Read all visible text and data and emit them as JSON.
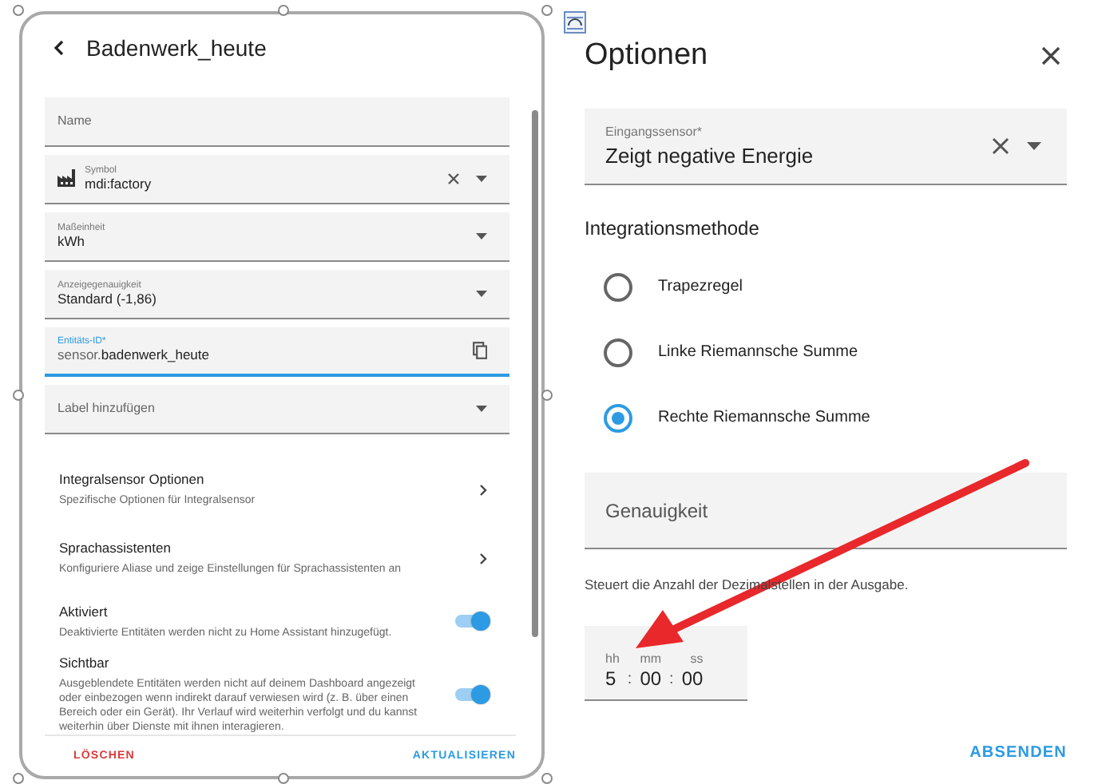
{
  "entity_dialog": {
    "title": "Badenwerk_heute",
    "fields": [
      {
        "kind": "text",
        "label": "Name"
      },
      {
        "kind": "icon-select",
        "label": "Symbol",
        "value": "mdi:factory"
      },
      {
        "kind": "select",
        "label": "Maßeinheit",
        "value": "kWh"
      },
      {
        "kind": "select",
        "label": "Anzeigegenauigkeit",
        "value": "Standard (-1,86)"
      },
      {
        "kind": "id",
        "label": "Entitäts-ID*",
        "prefix": "sensor.",
        "value": "badenwerk_heute",
        "focused": true
      },
      {
        "kind": "select",
        "label": "Label hinzufügen"
      }
    ],
    "links": [
      {
        "title": "Integralsensor Optionen",
        "description": "Spezifische Optionen für Integralsensor"
      },
      {
        "title": "Sprachassistenten",
        "description": "Konfiguriere Aliase und zeige Einstellungen für Sprachassistenten an"
      }
    ],
    "toggles": [
      {
        "title": "Aktiviert",
        "description": "Deaktivierte Entitäten werden nicht zu Home Assistant hinzugefügt.",
        "on": true
      },
      {
        "title": "Sichtbar",
        "description": "Ausgeblendete Entitäten werden nicht auf deinem Dashboard angezeigt oder einbezogen wenn indirekt darauf verwiesen wird (z. B. über einen Bereich oder ein Gerät). Ihr Verlauf wird weiterhin verfolgt und du kannst weiterhin über Dienste mit ihnen interagieren.",
        "on": true
      }
    ],
    "delete_button": "LÖSCHEN",
    "update_button": "AKTUALISIEREN"
  },
  "options_dialog": {
    "title": "Optionen",
    "input_sensor": {
      "label": "Eingangssensor*",
      "value": "Zeigt negative Energie"
    },
    "method_heading": "Integrationsmethode",
    "methods": [
      {
        "label": "Trapezregel",
        "selected": false
      },
      {
        "label": "Linke Riemannsche Summe",
        "selected": false
      },
      {
        "label": "Rechte Riemannsche Summe",
        "selected": true
      }
    ],
    "precision": {
      "placeholder": "Genauigkeit",
      "helper": "Steuert die Anzahl der Dezimalstellen in der Ausgabe."
    },
    "duration": [
      {
        "unit": "hh",
        "value": "5"
      },
      {
        "unit": "mm",
        "value": "00"
      },
      {
        "unit": "ss",
        "value": "00"
      }
    ],
    "separator": ":",
    "submit_button": "ABSENDEN"
  }
}
